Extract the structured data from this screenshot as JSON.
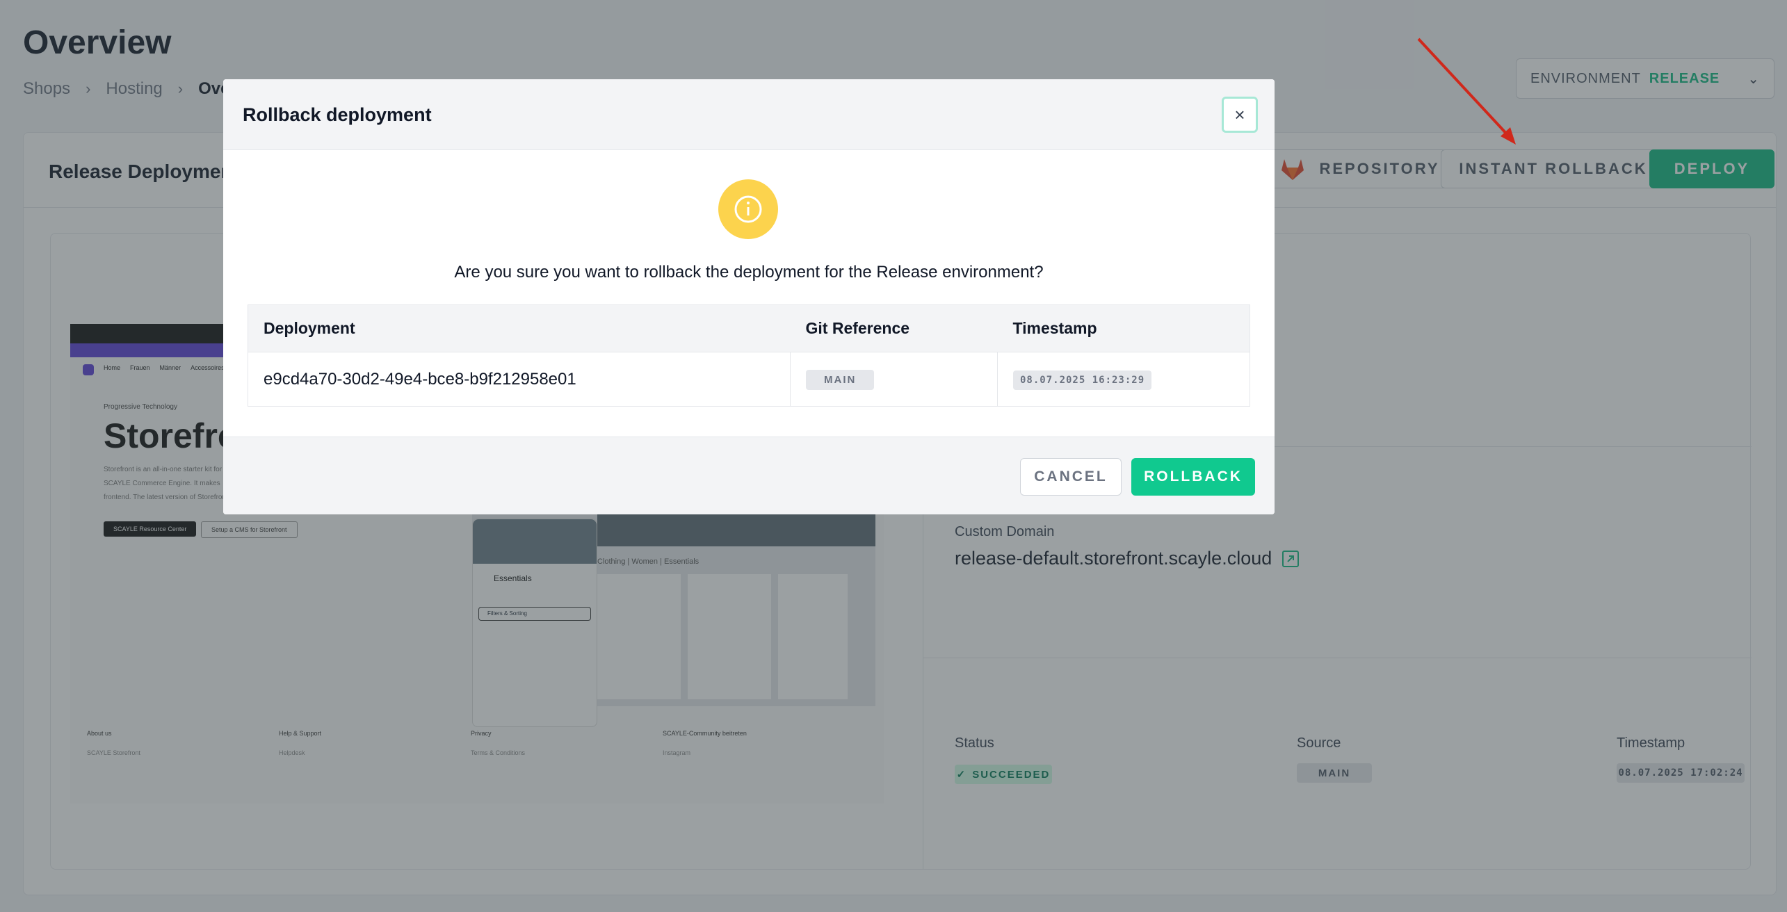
{
  "page": {
    "title": "Overview",
    "breadcrumb": [
      "Shops",
      "Hosting",
      "Overview"
    ]
  },
  "environment": {
    "label": "ENVIRONMENT",
    "value": "RELEASE"
  },
  "card": {
    "title": "Release Deployment",
    "repository_label": "REPOSITORY",
    "instant_rollback_label": "INSTANT ROLLBACK",
    "deploy_label": "DEPLOY"
  },
  "preview": {
    "nav": [
      "Home",
      "Frauen",
      "Männer",
      "Accessoires"
    ],
    "kicker": "Progressive Technology",
    "heading": "Storefront",
    "text": "Storefront is an all-in-one starter kit for the SCAYLE Commerce Engine. It makes frontend. The latest version of Storefront",
    "btn_primary": "SCAYLE Resource Center",
    "btn_secondary": "Setup a CMS for Storefront",
    "shop_crumb": "Clothing | Women | Essentials",
    "phone_title": "Essentials",
    "phone_search": "Filters & Sorting",
    "footer": [
      {
        "heading": "About us",
        "link": "SCAYLE Storefront"
      },
      {
        "heading": "Help & Support",
        "link": "Helpdesk"
      },
      {
        "heading": "Privacy",
        "link": "Terms & Conditions"
      },
      {
        "heading": "SCAYLE-Community beitreten",
        "link": "Instagram"
      }
    ]
  },
  "details": {
    "custom_domain_label": "Custom Domain",
    "custom_domain": "release-default.storefront.scayle.cloud",
    "status_label": "Status",
    "status_value": "SUCCEEDED",
    "source_label": "Source",
    "source_value": "MAIN",
    "timestamp_label": "Timestamp",
    "timestamp_value": "08.07.2025 17:02:24"
  },
  "modal": {
    "title": "Rollback deployment",
    "question": "Are you sure you want to rollback the deployment for the Release environment?",
    "columns": [
      "Deployment",
      "Git Reference",
      "Timestamp"
    ],
    "row": {
      "deployment": "e9cd4a70-30d2-49e4-bce8-b9f212958e01",
      "git_reference": "MAIN",
      "timestamp": "08.07.2025 16:23:29"
    },
    "cancel_label": "CANCEL",
    "rollback_label": "ROLLBACK"
  },
  "colors": {
    "accent": "#10b981",
    "warning": "#fcd34d",
    "annotation_arrow": "#d0281b"
  }
}
